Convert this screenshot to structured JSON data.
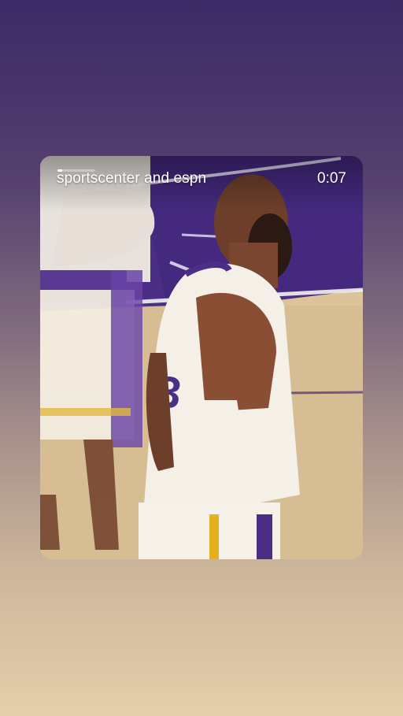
{
  "story": {
    "author": "sportscenter and espn",
    "timestamp": "0:07",
    "progress": 0.12,
    "media_description_icon": "video-frame"
  },
  "colors": {
    "bg_top": "#3b2a66",
    "bg_bottom": "#e3cfaa",
    "court_purple": "#4b2f86",
    "court_wood": "#dcc39a",
    "jersey": "#f4f0e8",
    "accent_gold": "#e3b21c"
  }
}
